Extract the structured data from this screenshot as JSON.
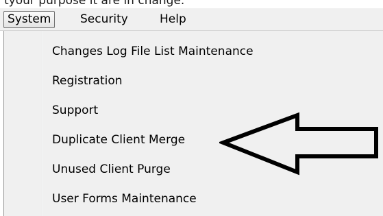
{
  "caption": "tyour purpose it are in change.",
  "menubar": {
    "items": [
      {
        "label": "System",
        "open": true
      },
      {
        "label": "Security"
      },
      {
        "label": "Help"
      }
    ]
  },
  "system_menu": {
    "items": [
      {
        "label": "Changes Log File List Maintenance"
      },
      {
        "label": "Registration"
      },
      {
        "label": "Support"
      },
      {
        "label": "Duplicate Client Merge",
        "annotated": true
      },
      {
        "label": "Unused Client Purge"
      },
      {
        "label": "User Forms Maintenance"
      }
    ]
  },
  "annotation": {
    "icon": "arrow-left-icon",
    "color": "#000000"
  }
}
